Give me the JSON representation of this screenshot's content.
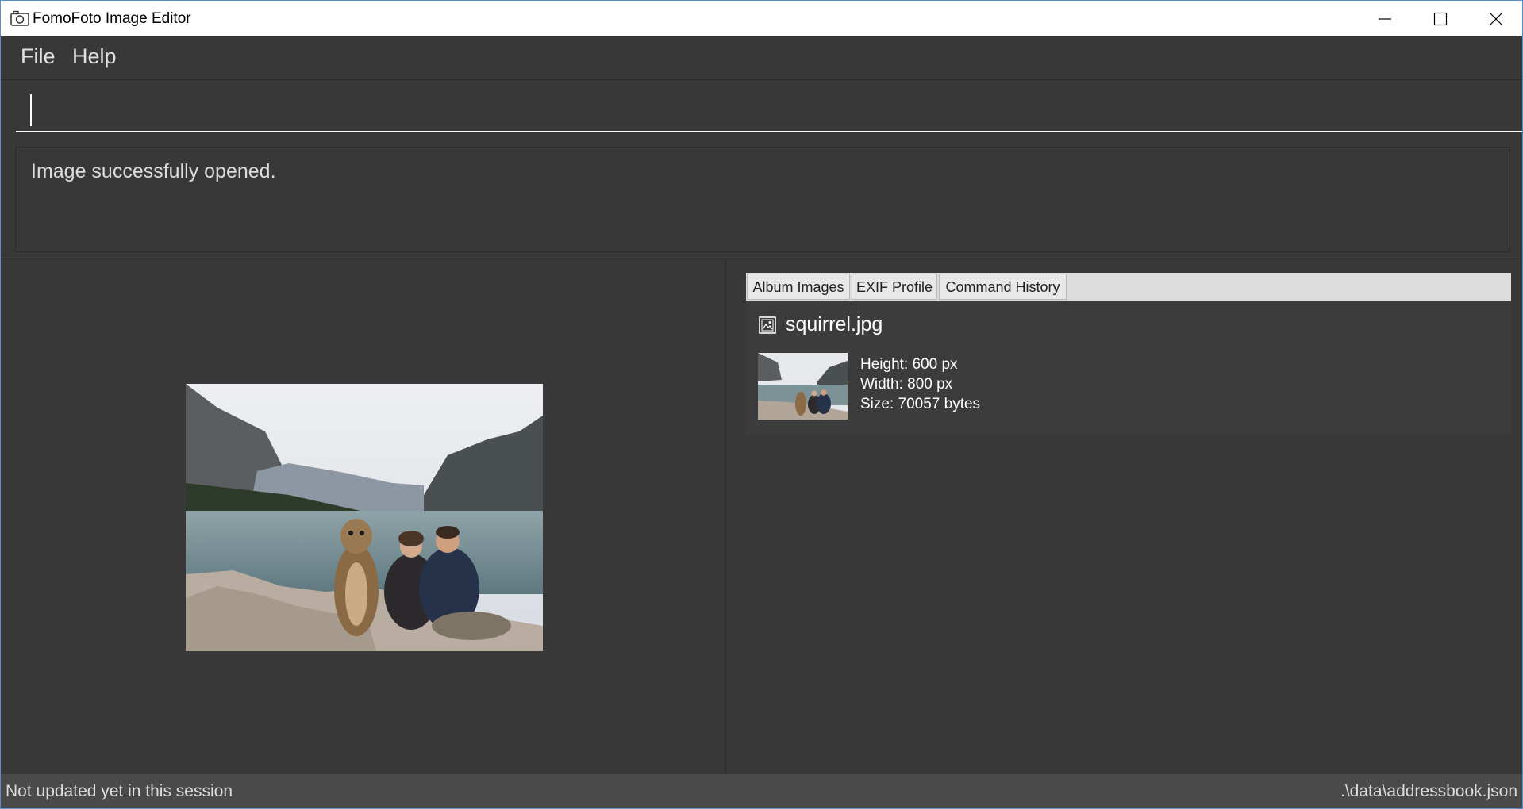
{
  "window": {
    "title": "FomoFoto Image Editor",
    "icon": "camera-icon",
    "controls": [
      "minimize-icon",
      "maximize-icon",
      "close-icon"
    ]
  },
  "menu": {
    "file_label": "File",
    "help_label": "Help"
  },
  "command": {
    "value": "",
    "placeholder": ""
  },
  "result": {
    "message": "Image successfully opened."
  },
  "tabs": [
    {
      "label": "Album Images",
      "selected": true
    },
    {
      "label": "EXIF Profile",
      "selected": false
    },
    {
      "label": "Command History",
      "selected": false
    }
  ],
  "album": {
    "items": [
      {
        "icon": "picture-frame-icon",
        "name": "squirrel.jpg",
        "height": "Height: 600 px",
        "width": "Width: 800 px",
        "size": "Size: 70057 bytes"
      }
    ]
  },
  "status": {
    "left": "Not updated yet in this session",
    "right": ".\\data\\addressbook.json"
  },
  "colors": {
    "background": "#383838",
    "statusbar": "#4a4a4a",
    "titlebar": "#ffffff",
    "window_border": "#5a8fc8",
    "text": "#dcdcdc"
  }
}
